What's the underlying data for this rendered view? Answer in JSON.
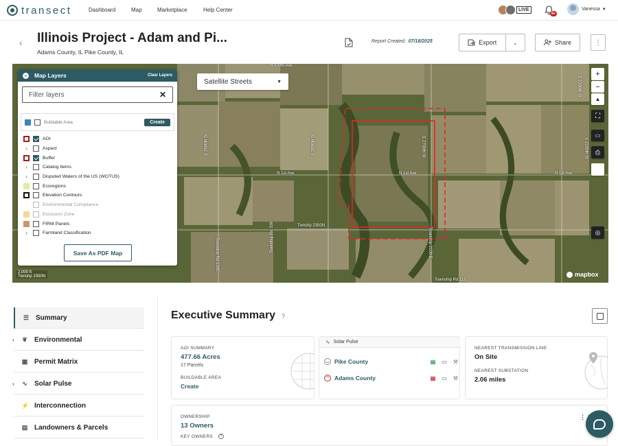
{
  "brand": {
    "name": "transect",
    "accent": "#2d5b63"
  },
  "nav": {
    "links": [
      "Dashboard",
      "Map",
      "Marketplace",
      "Help Center"
    ],
    "live_label": "LIVE",
    "notifications_badge": "9+",
    "user_name": "Vanessa"
  },
  "project": {
    "title": "Illinois Project - Adam and Pi...",
    "location": "Adams County, IL Pike County, IL",
    "report_label": "Report Created:",
    "report_date": "07/18/2025"
  },
  "actions": {
    "export": "Export",
    "share": "Share"
  },
  "map": {
    "style_selector": "Satellite Streets",
    "road_labels": [
      "N 100th Ave",
      "N 1st Ave",
      "N 1st Ave",
      "N 1st Ave",
      "Twnshp 2350N",
      "Township Rd 115",
      "E 2600th St",
      "E 2600th St",
      "E 2200th St",
      "Township Rd 338",
      "Township Rd 100E",
      "Township 2100 E",
      "E 2700th St",
      "E 2200th St"
    ],
    "scale": "2,000 ft",
    "scale_sub": "Twnshp 2350N",
    "attribution": "mapbox"
  },
  "layers_panel": {
    "title": "Map Layers",
    "clear": "Clear Layers",
    "filter_placeholder": "Filter layers",
    "buildable_label": "Buildable Area",
    "create_label": "Create",
    "items": [
      {
        "label": "AOI",
        "checked": true,
        "swatch": "#a31d1d",
        "swatch_type": "outline",
        "expandable": false,
        "dim": false
      },
      {
        "label": "Aspect",
        "checked": false,
        "swatch": "",
        "swatch_type": "none",
        "expandable": true,
        "dim": false
      },
      {
        "label": "Buffer",
        "checked": true,
        "swatch": "#a31d1d",
        "swatch_type": "outline",
        "expandable": false,
        "dim": false
      },
      {
        "label": "Catalog Items",
        "checked": false,
        "swatch": "",
        "swatch_type": "none",
        "expandable": true,
        "dim": false
      },
      {
        "label": "Disputed Waters of the US (WOTUS)",
        "checked": false,
        "swatch": "",
        "swatch_type": "none",
        "expandable": true,
        "dim": false
      },
      {
        "label": "Ecoregions",
        "checked": false,
        "swatch": "#d8f0a5",
        "swatch_type": "fill",
        "expandable": false,
        "dim": false
      },
      {
        "label": "Elevation Contours",
        "checked": false,
        "swatch": "#111111",
        "swatch_type": "outline",
        "expandable": false,
        "dim": false
      },
      {
        "label": "Environmental Compliance",
        "checked": false,
        "swatch": "",
        "swatch_type": "none",
        "expandable": false,
        "dim": true
      },
      {
        "label": "Exclusion Zone",
        "checked": false,
        "swatch": "#f5d79a",
        "swatch_type": "fill",
        "expandable": false,
        "dim": true
      },
      {
        "label": "FIRM Panels",
        "checked": false,
        "swatch": "#cf9468",
        "swatch_type": "fill",
        "expandable": false,
        "dim": false
      },
      {
        "label": "Farmland Classification",
        "checked": false,
        "swatch": "",
        "swatch_type": "none",
        "expandable": true,
        "dim": false
      }
    ],
    "save_pdf": "Save As PDF Map"
  },
  "sidebar": {
    "items": [
      {
        "label": "Summary",
        "icon": "list-icon",
        "glyph": "☰",
        "expandable": false,
        "active": true
      },
      {
        "label": "Environmental",
        "icon": "leaf-icon",
        "glyph": "❦",
        "expandable": true,
        "active": false
      },
      {
        "label": "Permit Matrix",
        "icon": "grid-icon",
        "glyph": "▦",
        "expandable": false,
        "active": false
      },
      {
        "label": "Solar Pulse",
        "icon": "pulse-icon",
        "glyph": "∿",
        "expandable": true,
        "active": false
      },
      {
        "label": "Interconnection",
        "icon": "plug-icon",
        "glyph": "⚡",
        "expandable": false,
        "active": false
      },
      {
        "label": "Landowners & Parcels",
        "icon": "briefcase-icon",
        "glyph": "▤",
        "expandable": false,
        "active": false
      }
    ]
  },
  "summary": {
    "title": "Executive Summary",
    "help_glyph": "?",
    "aoi": {
      "label": "AOI SUMMARY",
      "acres": "477.66 Acres",
      "parcels": "17 Parcels",
      "buildable_label": "BUILDABLE AREA",
      "buildable_action": "Create"
    },
    "solar_pulse": {
      "title": "Solar Pulse",
      "counties": [
        "Pike County",
        "Adams County"
      ]
    },
    "transmission": {
      "label": "NEAREST TRANSMISSION LINE",
      "value": "On Site",
      "substation_label": "NEAREST SUBSTATION",
      "substation_value": "2.06 miles"
    },
    "ownership": {
      "label": "OWNERSHIP",
      "owners": "13 Owners",
      "key_owners_label": "KEY OWNERS"
    }
  }
}
